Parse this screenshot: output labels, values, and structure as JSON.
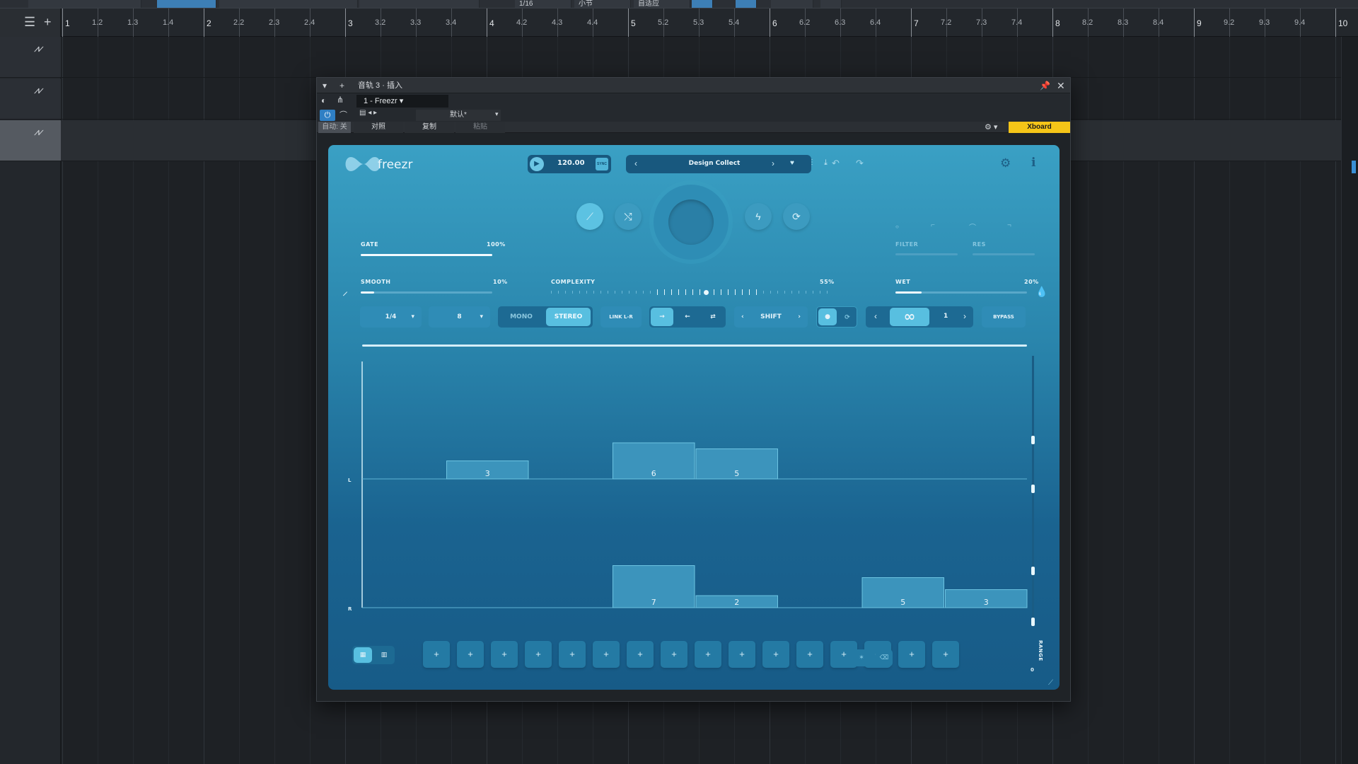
{
  "topbar": {
    "grid": "1/16",
    "timebase": "小节",
    "snap": "自适应"
  },
  "ruler": {
    "labels": [
      "1",
      "1.2",
      "1.3",
      "1.4",
      "2",
      "2.2",
      "2.3",
      "2.4",
      "3",
      "3.2",
      "3.3",
      "3.4",
      "4",
      "4.2",
      "4.3",
      "4.4",
      "5",
      "5.2",
      "5.3",
      "5.4",
      "6",
      "6.2",
      "6.3",
      "6.4",
      "7",
      "7.2",
      "7.3",
      "7.4",
      "8",
      "8.2",
      "8.3",
      "8.4",
      "9",
      "9.2",
      "9.3",
      "9.4",
      "10"
    ]
  },
  "plugin_window": {
    "title": "音轨 3 · 插入",
    "preset_slot": "1 - Freezr",
    "preset_name": "默认*",
    "auto_label": "自动: 关",
    "compare_label": "对照",
    "copy_label": "复制",
    "paste_label": "粘贴",
    "xboard_label": "Xboard"
  },
  "freezr": {
    "logo": "freezr",
    "tempo": "120.00",
    "sync_label": "SYNC",
    "preset": "Design Collect",
    "gate": {
      "label": "GATE",
      "value": "100%",
      "level": 1.0
    },
    "smooth": {
      "label": "SMOOTH",
      "value": "10%",
      "level": 0.1
    },
    "complexity": {
      "label": "COMPLEXITY",
      "value": "55%",
      "level": 0.55
    },
    "wet": {
      "label": "WET",
      "value": "20%",
      "level": 0.2
    },
    "filter_label": "FILTER",
    "res_label": "RES",
    "rate_value": "1/4",
    "steps_value": "8",
    "mono_label": "MONO",
    "stereo_label": "STEREO",
    "link_label": "LINK L-R",
    "shift_label": "SHIFT",
    "loop_count": "1",
    "bypass_label": "BYPASS",
    "channel_l": "L",
    "channel_r": "R",
    "range_label": "RANGE",
    "range_value": "0",
    "step_symbol": "+",
    "steps_count": 16
  },
  "chart_data": {
    "type": "bar",
    "series": [
      {
        "name": "L",
        "values": [
          0,
          3,
          0,
          6,
          5,
          0,
          0,
          0
        ]
      },
      {
        "name": "R",
        "values": [
          0,
          0,
          0,
          7,
          2,
          0,
          5,
          3
        ]
      }
    ]
  }
}
